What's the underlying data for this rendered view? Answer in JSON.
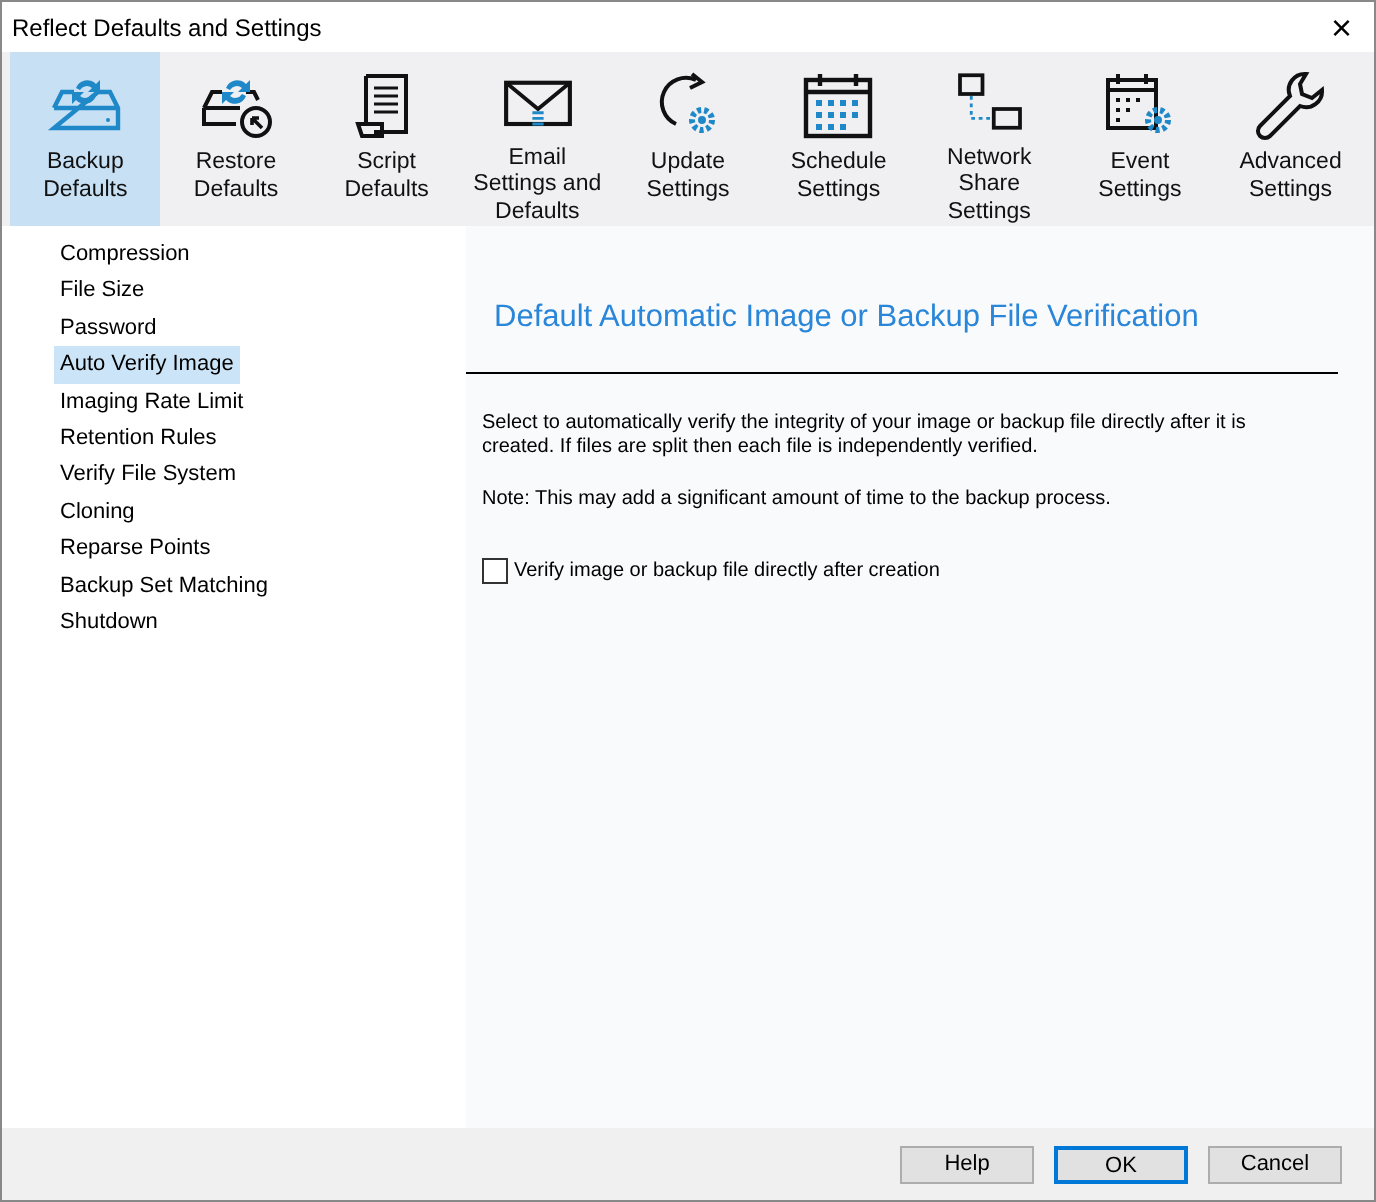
{
  "window": {
    "title": "Reflect Defaults and Settings",
    "close": "×"
  },
  "toolbar": [
    {
      "label": "Backup Defaults",
      "selected": true
    },
    {
      "label": "Restore Defaults",
      "selected": false
    },
    {
      "label": "Script Defaults",
      "selected": false
    },
    {
      "label": "Email Settings and Defaults",
      "selected": false
    },
    {
      "label": "Update Settings",
      "selected": false
    },
    {
      "label": "Schedule Settings",
      "selected": false
    },
    {
      "label": "Network Share Settings",
      "selected": false
    },
    {
      "label": "Event Settings",
      "selected": false
    },
    {
      "label": "Advanced Settings",
      "selected": false
    }
  ],
  "sidebar": {
    "items": [
      {
        "label": "Compression",
        "selected": false
      },
      {
        "label": "File Size",
        "selected": false
      },
      {
        "label": "Password",
        "selected": false
      },
      {
        "label": "Auto Verify Image",
        "selected": true
      },
      {
        "label": "Imaging Rate Limit",
        "selected": false
      },
      {
        "label": "Retention Rules",
        "selected": false
      },
      {
        "label": "Verify File System",
        "selected": false
      },
      {
        "label": "Cloning",
        "selected": false
      },
      {
        "label": "Reparse Points",
        "selected": false
      },
      {
        "label": "Backup Set Matching",
        "selected": false
      },
      {
        "label": "Shutdown",
        "selected": false
      }
    ]
  },
  "content": {
    "heading": "Default Automatic Image or Backup File Verification",
    "description": "Select to automatically verify the integrity of your image or backup file directly after it is created. If files are split then each file is independently verified.",
    "note": "Note: This may add a significant amount of time to the backup process.",
    "checkbox": {
      "label": "Verify image or backup file directly after creation",
      "checked": false
    }
  },
  "buttons": [
    {
      "label": "Help",
      "default": false
    },
    {
      "label": "OK",
      "default": true
    },
    {
      "label": "Cancel",
      "default": false
    }
  ]
}
